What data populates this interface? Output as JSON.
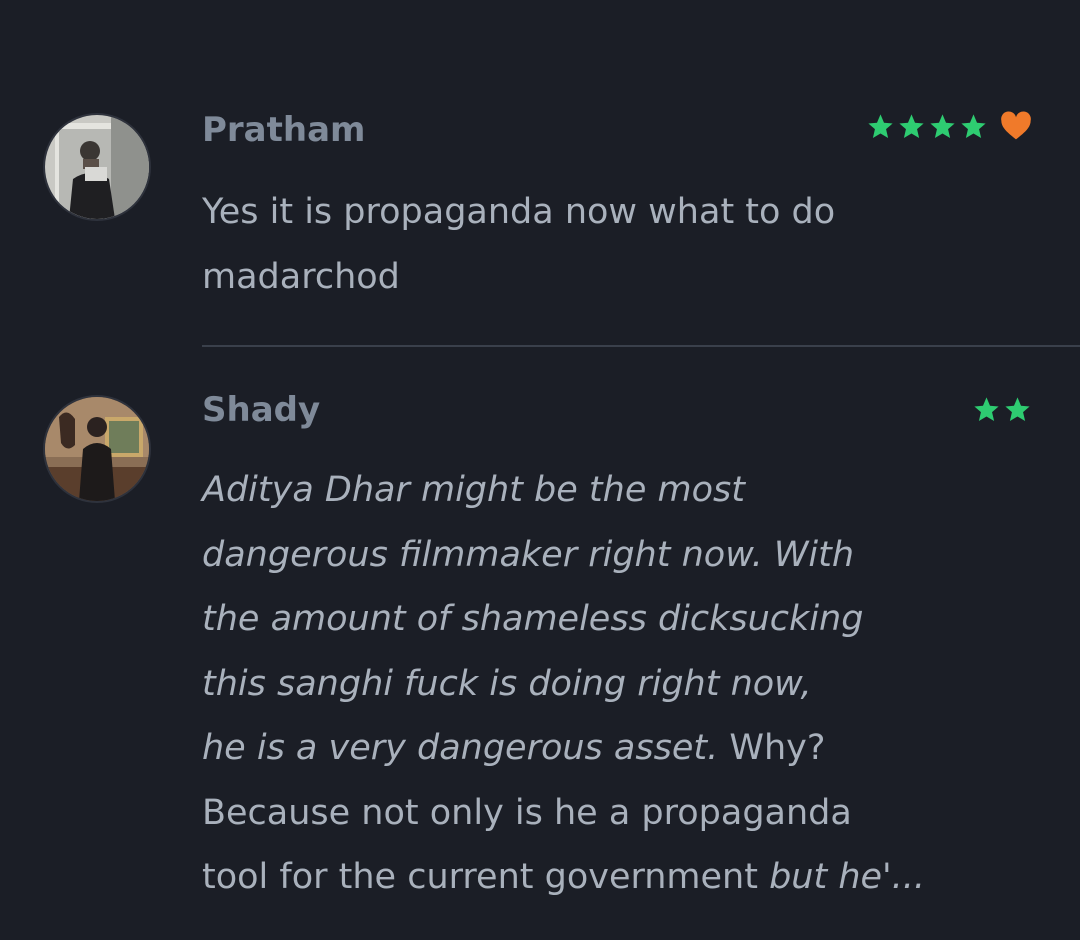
{
  "reviews": [
    {
      "username": "Pratham",
      "stars": 4,
      "liked": true,
      "text_lines": [
        "Yes it is propaganda now what to do",
        "madarchod"
      ]
    },
    {
      "username": "Shady",
      "stars": 2,
      "liked": false,
      "text_lines": [
        "Aditya Dhar might be the most",
        "dangerous filmmaker right now. With",
        "the amount of shameless dicksucking",
        "this sanghi fuck is doing right now,",
        "he is a very dangerous asset.",
        " Why?",
        "Because not only is he a propaganda",
        "tool for the current government ",
        "but he'..."
      ]
    }
  ],
  "colors": {
    "background": "#1b1e26",
    "star": "#2ecc71",
    "heart": "#f07a2a",
    "username": "#7f8a99",
    "text": "#a9b1bc",
    "divider": "#3a404b"
  },
  "icons": {
    "star": "star-icon",
    "like": "heart-icon"
  }
}
